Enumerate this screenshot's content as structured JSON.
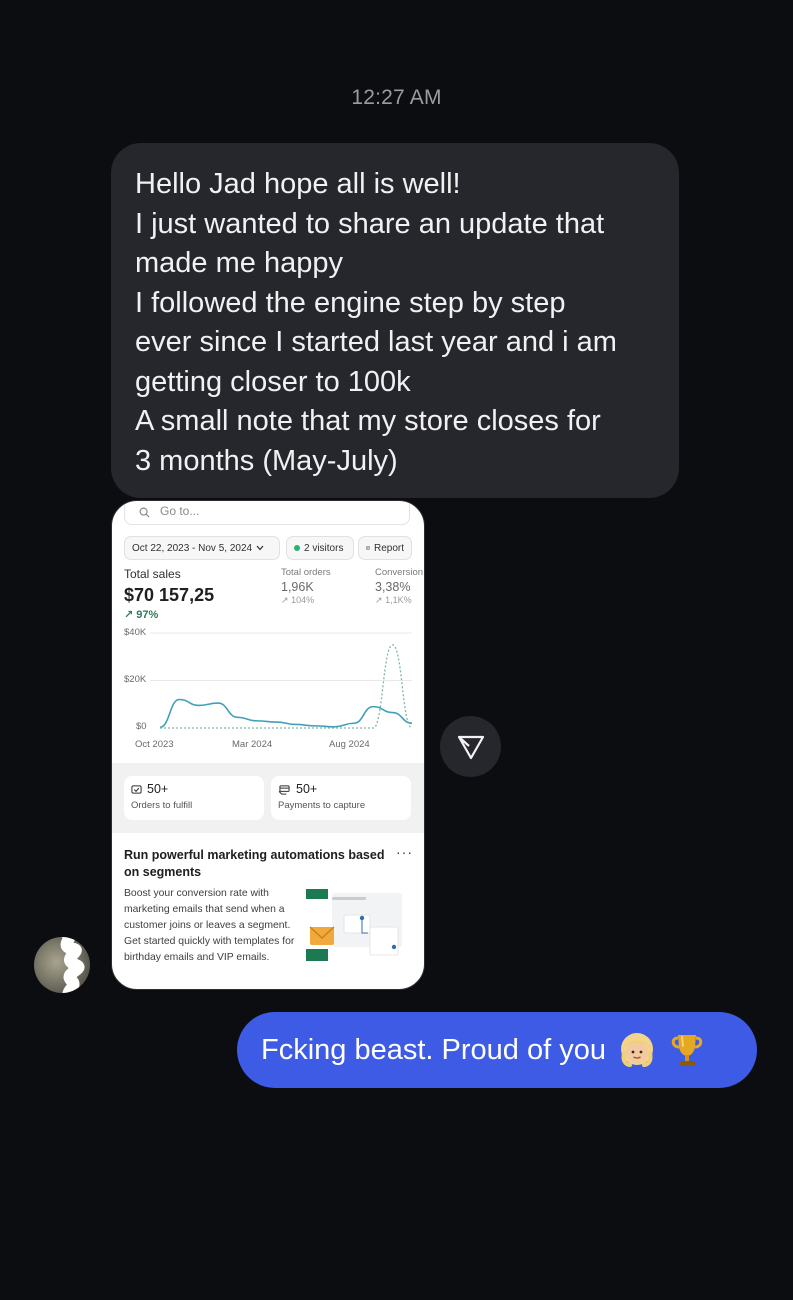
{
  "thread": {
    "timestamp": "12:27 AM"
  },
  "incoming_message": {
    "lines": [
      "Hello Jad hope all is well!",
      "I just wanted to share an update that",
      "made me happy",
      "I followed the engine step by step",
      "ever since I started last year and i am",
      "getting closer to 100k",
      "A small note that my store closes for",
      "3 months (May-July)"
    ]
  },
  "shared_screenshot": {
    "search_placeholder": "Go to...",
    "date_range": "Oct 22, 2023 - Nov 5, 2024",
    "visitors": "2 visitors",
    "report_label": "Report",
    "total_sales_label": "Total sales",
    "total_sales_value": "$70 157,25",
    "total_sales_delta": "97%",
    "total_orders_label": "Total orders",
    "total_orders_value": "1,96K",
    "total_orders_delta": "104%",
    "conversion_label": "Conversion",
    "conversion_value": "3,38%",
    "conversion_delta": "1,1K%",
    "chart_data": {
      "type": "line",
      "x": [
        "Oct 2023",
        "Nov 2023",
        "Dec 2023",
        "Jan 2024",
        "Feb 2024",
        "Mar 2024",
        "Apr 2024",
        "May 2024",
        "Jun 2024",
        "Jul 2024",
        "Aug 2024",
        "Sep 2024",
        "Oct 2024",
        "Nov 2024"
      ],
      "xticks": [
        "Oct 2023",
        "Mar 2024",
        "Aug 2024"
      ],
      "yticks": [
        "$40K",
        "$20K",
        "$0"
      ],
      "ylim": [
        0,
        40000
      ],
      "series": [
        {
          "values": [
            300,
            12000,
            9500,
            10500,
            4500,
            3000,
            2500,
            1500,
            900,
            500,
            2000,
            9000,
            6500,
            2000
          ]
        },
        {
          "values": [
            0,
            0,
            0,
            0,
            0,
            0,
            0,
            0,
            0,
            0,
            0,
            0,
            35000,
            0
          ]
        }
      ],
      "colors": [
        "#3fa0b8",
        "#7fb6a4"
      ]
    },
    "orders_count": "50+",
    "orders_label": "Orders to fulfill",
    "payments_count": "50+",
    "payments_label": "Payments to capture",
    "promo_title": "Run powerful marketing automations based on segments",
    "promo_more": "···",
    "promo_body": "Boost your conversion rate with marketing emails that send when a customer joins or leaves a segment. Get started quickly with templates for birthday emails and VIP emails."
  },
  "outgoing_message": {
    "text": "Fcking beast. Proud of you",
    "emojis": [
      "girl-emoji",
      "trophy-emoji"
    ]
  },
  "icons": [
    "send-arrow-icon",
    "search-icon",
    "chevron-down-icon",
    "report-icon",
    "orders-icon",
    "payments-icon"
  ]
}
